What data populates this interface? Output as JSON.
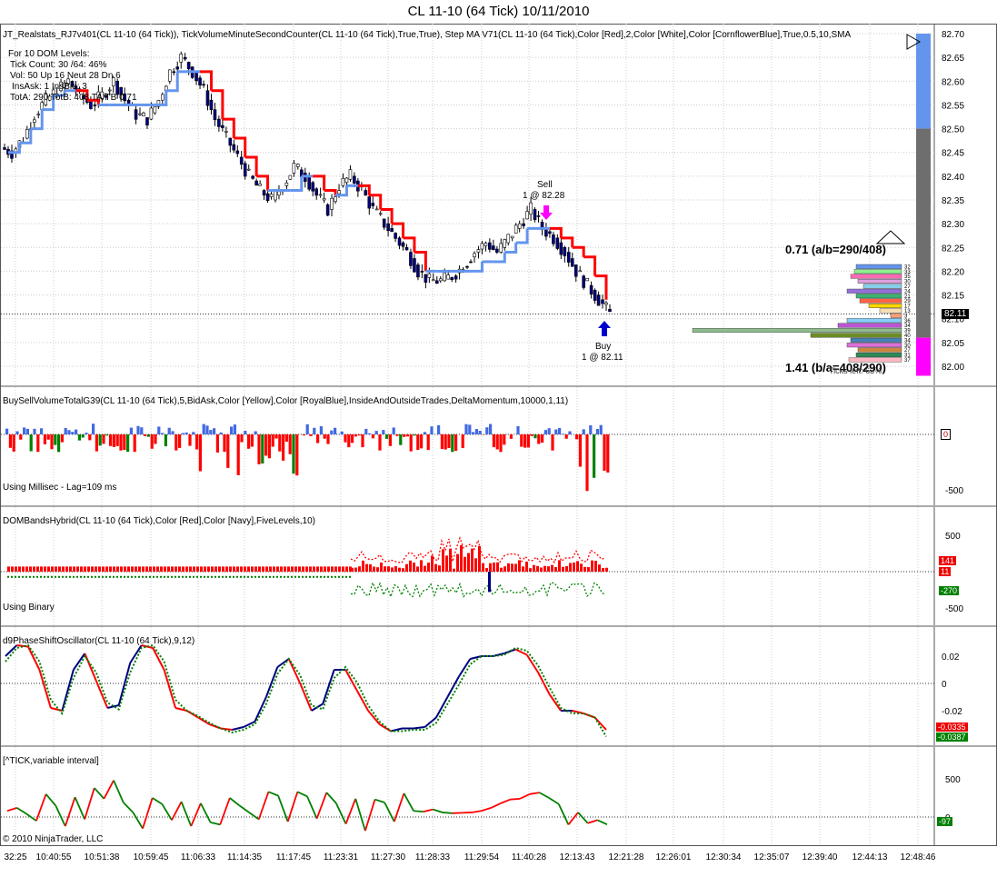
{
  "title": "CL 11-10 (64 Tick)  10/11/2010",
  "copyright": "© 2010 NinjaTrader, LLC",
  "colors": {
    "ma_up": "#6495ED",
    "ma_down": "#FF0000",
    "up_candle": "#FFFFFF",
    "down_candle": "#000080",
    "sell_arrow": "#FF00FF",
    "buy_arrow": "#0000CD",
    "green": "#008000",
    "red": "#FF0000",
    "navy": "#000080",
    "royalblue": "#4169E1",
    "gray_bar": "#6E6E6E"
  },
  "panels": {
    "price": {
      "label": "JT_Realstats_RJ7v401(CL 11-10 (64 Tick)), TickVolumeMinuteSecondCounter(CL 11-10 (64 Tick),True,True), Step MA  V71(CL 11-10 (64 Tick),Color [Red],2,Color [White],Color [CornflowerBlue],True,0.5,10,SMA",
      "dom_lines": [
        "For 10 DOM Levels:",
        "Tick Count: 30 /64: 46%",
        "Vol: 50   Up 16   Neut 28   Dn 6",
        "InsAsk: 1   InsBid: 3",
        "TotA: 290  TotB: 408  TA/TB 0.71"
      ],
      "ratio_top": "0.71 (a/b=290/408)",
      "ratio_bottom": "1.41 (b/a=408/290)",
      "ticks_label": "Ticks left: 63%",
      "sell_label": "Sell",
      "sell_detail": "1 @ 82.28",
      "buy_label": "Buy",
      "buy_detail": "1 @ 82.11",
      "last_price": "82.11",
      "dom_sizes": [
        "32",
        "33",
        "35",
        "30",
        "27",
        "24",
        "21",
        "29",
        "17",
        "13",
        "3",
        "36",
        "34",
        "39",
        "40",
        "34",
        "30",
        "27",
        "31",
        "37"
      ]
    },
    "buysell": {
      "label": "BuySellVolumeTotalG39(CL 11-10 (64 Tick),5,BidAsk,Color [Yellow],Color [RoyalBlue],InsideAndOutsideTrades,DeltaMomentum,10000,1,11)",
      "note": "Using Millisec - Lag=109 ms",
      "current": "0"
    },
    "dom": {
      "label": "DOMBandsHybrid(CL 11-10 (64 Tick),Color [Red],Color [Navy],FiveLevels,10)",
      "note": "Using Binary",
      "val1": "141",
      "val2": "11",
      "val3": "-270"
    },
    "osc": {
      "label": "d9PhaseShiftOscillator(CL 11-10 (64 Tick),9,12)",
      "val1": "-0.0335",
      "val2": "-0.0387"
    },
    "tick": {
      "label": "[^TICK,variable interval]",
      "current": "-97"
    }
  },
  "chart_data": [
    {
      "type": "line",
      "title": "CL 11-10 (64 Tick)  10/11/2010",
      "ylim": [
        82.0,
        82.7
      ],
      "yticks": [
        "82.70",
        "82.65",
        "82.60",
        "82.55",
        "82.50",
        "82.45",
        "82.40",
        "82.35",
        "82.30",
        "82.25",
        "82.20",
        "82.15",
        "82.10",
        "82.05",
        "82.00"
      ],
      "x_tick_labels": [
        "32:25",
        "10:40:55",
        "10:51:38",
        "10:59:45",
        "11:06:33",
        "11:14:35",
        "11:17:45",
        "11:23:31",
        "11:27:30",
        "11:28:33",
        "11:29:54",
        "11:40:28",
        "12:13:43",
        "12:21:28",
        "12:26:01",
        "12:30:34",
        "12:35:07",
        "12:39:40",
        "12:44:13",
        "12:48:46"
      ],
      "series": [
        {
          "values": [
            82.45,
            82.48,
            82.53,
            82.56,
            82.58,
            82.6,
            82.57,
            82.55,
            82.57,
            82.6,
            82.56,
            82.53,
            82.52,
            82.56,
            82.62,
            82.65,
            82.62,
            82.58,
            82.52,
            82.48,
            82.44,
            82.4,
            82.37,
            82.35,
            82.38,
            82.42,
            82.4,
            82.36,
            82.33,
            82.38,
            82.4,
            82.37,
            82.33,
            82.3,
            82.27,
            82.24,
            82.2,
            82.18,
            82.18,
            82.19,
            82.21,
            82.24,
            82.26,
            82.24,
            82.27,
            82.3,
            82.33,
            82.29,
            82.27,
            82.24,
            82.2,
            82.17,
            82.14,
            82.11
          ]
        },
        {
          "values": [
            82.45,
            82.47,
            82.5,
            82.54,
            82.57,
            82.58,
            82.58,
            82.56,
            82.55,
            82.55,
            82.55,
            82.55,
            82.55,
            82.55,
            82.58,
            82.62,
            82.62,
            82.62,
            82.58,
            82.52,
            82.48,
            82.44,
            82.4,
            82.37,
            82.37,
            82.37,
            82.4,
            82.4,
            82.37,
            82.36,
            82.38,
            82.38,
            82.36,
            82.33,
            82.3,
            82.27,
            82.24,
            82.2,
            82.2,
            82.2,
            82.2,
            82.2,
            82.22,
            82.22,
            82.24,
            82.26,
            82.29,
            82.29,
            82.29,
            82.27,
            82.25,
            82.23,
            82.19,
            82.14
          ]
        }
      ]
    },
    {
      "type": "bar",
      "ylim": [
        -550,
        150
      ],
      "yticks": [
        "0",
        "-500"
      ]
    },
    {
      "type": "bar",
      "ylim": [
        -600,
        700
      ],
      "yticks": [
        "500",
        "0",
        "-500"
      ]
    },
    {
      "type": "line",
      "ylim": [
        -0.045,
        0.03
      ],
      "yticks": [
        "0.02",
        "0",
        "-0.02"
      ],
      "series": [
        {
          "values": [
            0.02,
            0.028,
            0.027,
            0.01,
            -0.018,
            -0.02,
            0.01,
            0.022,
            0.002,
            -0.018,
            -0.016,
            0.015,
            0.028,
            0.026,
            0.01,
            -0.018,
            -0.02,
            -0.025,
            -0.03,
            -0.033,
            -0.034,
            -0.032,
            -0.028,
            -0.01,
            0.012,
            0.018,
            0.0,
            -0.02,
            -0.015,
            0.01,
            0.01,
            -0.005,
            -0.02,
            -0.03,
            -0.035,
            -0.033,
            -0.033,
            -0.032,
            -0.025,
            -0.01,
            0.005,
            0.018,
            0.02,
            0.02,
            0.022,
            0.025,
            0.021,
            0.008,
            -0.008,
            -0.02,
            -0.02,
            -0.022,
            -0.025,
            -0.034
          ]
        },
        {
          "values": [
            0.016,
            0.026,
            0.028,
            0.016,
            -0.012,
            -0.022,
            0.004,
            0.02,
            0.008,
            -0.014,
            -0.019,
            0.008,
            0.026,
            0.028,
            0.016,
            -0.012,
            -0.02,
            -0.024,
            -0.029,
            -0.033,
            -0.036,
            -0.034,
            -0.03,
            -0.015,
            0.007,
            0.018,
            0.006,
            -0.016,
            -0.019,
            0.004,
            0.012,
            0.001,
            -0.016,
            -0.028,
            -0.035,
            -0.035,
            -0.034,
            -0.034,
            -0.029,
            -0.015,
            -0.001,
            0.014,
            0.02,
            0.02,
            0.021,
            0.026,
            0.024,
            0.013,
            -0.003,
            -0.018,
            -0.022,
            -0.022,
            -0.025,
            -0.039
          ]
        }
      ]
    },
    {
      "type": "line",
      "ylim": [
        -300,
        700
      ],
      "yticks": [
        "500",
        "0"
      ],
      "series": [
        {
          "values": [
            80,
            120,
            40,
            -50,
            300,
            150,
            -120,
            260,
            -30,
            380,
            240,
            480,
            190,
            60,
            -150,
            250,
            170,
            -40,
            200,
            -120,
            180,
            -70,
            -100,
            250,
            150,
            60,
            -30,
            330,
            280,
            -60,
            330,
            270,
            -20,
            320,
            180,
            -90,
            240,
            -180,
            230,
            190,
            -60,
            310,
            80,
            70,
            100,
            60,
            50,
            55,
            60,
            80,
            120,
            180,
            230,
            240,
            300,
            320,
            250,
            170,
            -100,
            60,
            -80,
            -40,
            -97
          ]
        }
      ]
    }
  ]
}
